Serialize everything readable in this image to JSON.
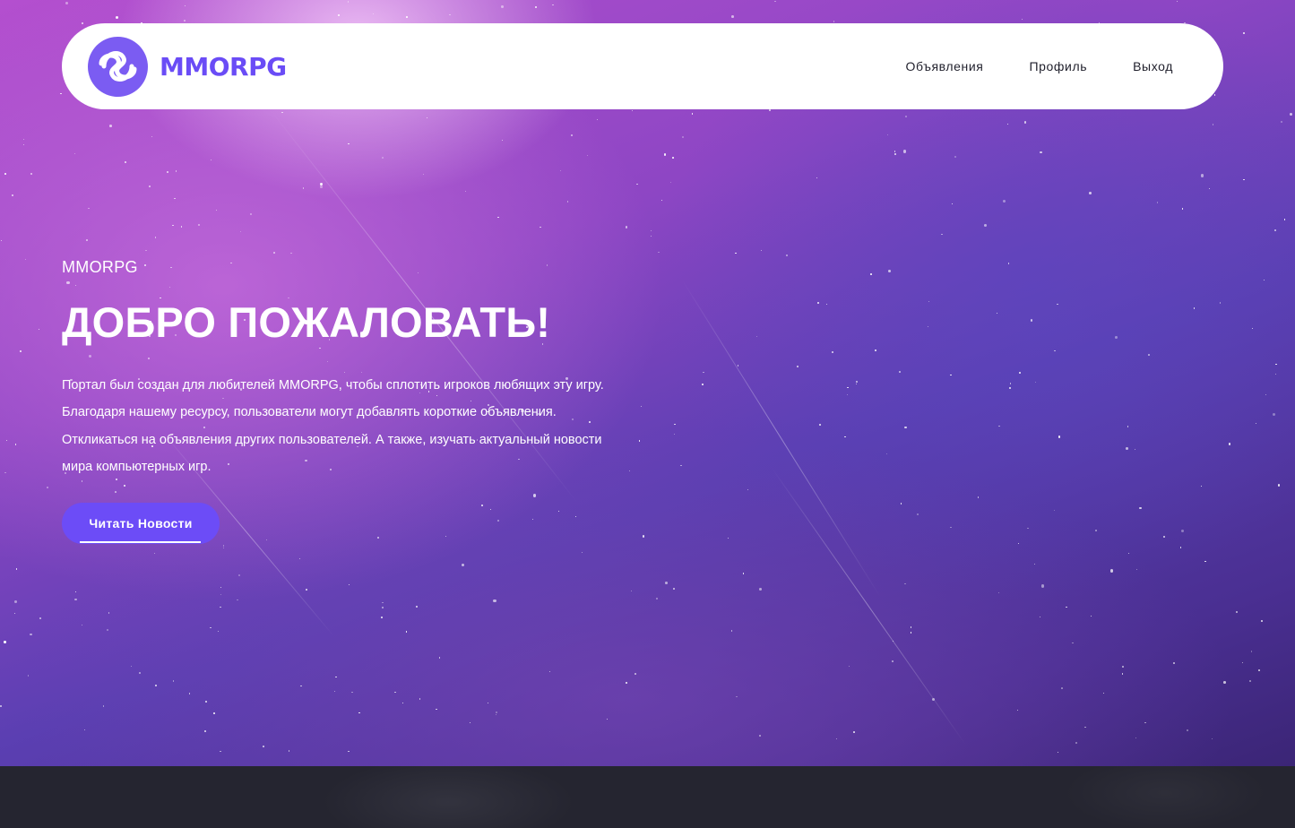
{
  "colors": {
    "accent": "#6c4cf7",
    "logo_text": "#6a4cf6",
    "header_bg": "#ffffff",
    "hero_text": "#ffffff",
    "bottom_band": "#252530"
  },
  "header": {
    "logo": {
      "icon": "mmorpg-logo-icon",
      "text": "MMORPG"
    },
    "nav": [
      {
        "label": "Объявления"
      },
      {
        "label": "Профиль"
      },
      {
        "label": "Выход"
      }
    ]
  },
  "hero": {
    "eyebrow": "MMORPG",
    "headline": "ДОБРО ПОЖАЛОВАТЬ!",
    "intro_lines": [
      "Портал был создан для любителей MMORPG, чтобы сплотить игроков любящих эту игру.",
      "Благодаря нашему ресурсу, пользователи могут добавлять короткие объявления.",
      "Откликаться на объявления других пользователей. А также, изучать актуальный новости",
      "мира компьютерных игр."
    ],
    "cta_label": "Читать Новости"
  }
}
